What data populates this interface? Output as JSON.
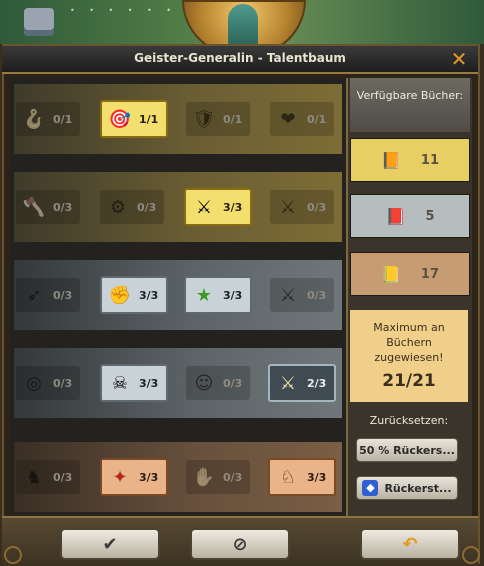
{
  "window": {
    "title": "Geister-Generalin  - Talentbaum",
    "close_icon": "close-x-icon"
  },
  "tree": {
    "rows": [
      {
        "tier": "gold",
        "talents": [
          {
            "icon": "horn-icon",
            "count": "0/1",
            "state": "inactive"
          },
          {
            "icon": "warrior-target-icon",
            "count": "1/1",
            "state": "gold-on"
          },
          {
            "icon": "shield-plus-icon",
            "count": "0/1",
            "state": "inactive"
          },
          {
            "icon": "heart-burst-icon",
            "count": "0/1",
            "state": "inactive"
          }
        ]
      },
      {
        "tier": "gold",
        "talents": [
          {
            "icon": "axe-icon",
            "count": "0/3",
            "state": "inactive"
          },
          {
            "icon": "catapult-icon",
            "count": "0/3",
            "state": "inactive"
          },
          {
            "icon": "crossed-swords-soldier-icon",
            "count": "3/3",
            "state": "gold-on"
          },
          {
            "icon": "swords-clock-icon",
            "count": "0/3",
            "state": "inactive"
          }
        ]
      },
      {
        "tier": "silver",
        "talents": [
          {
            "icon": "arrowhead-icon",
            "count": "0/3",
            "state": "inactive"
          },
          {
            "icon": "fist-icon",
            "count": "3/3",
            "state": "silver-on"
          },
          {
            "icon": "star-plus-icon",
            "count": "3/3",
            "state": "silver-on"
          },
          {
            "icon": "swords-plus-icon",
            "count": "0/3",
            "state": "inactive"
          }
        ]
      },
      {
        "tier": "silver",
        "talents": [
          {
            "icon": "target-arrow-icon",
            "count": "0/3",
            "state": "inactive"
          },
          {
            "icon": "skull-heart-icon",
            "count": "3/3",
            "state": "silver-on"
          },
          {
            "icon": "monk-plus-icon",
            "count": "0/3",
            "state": "inactive"
          },
          {
            "icon": "crossed-swords-soldier-icon",
            "count": "2/3",
            "state": "dark-on"
          }
        ]
      },
      {
        "tier": "bronze",
        "talents": [
          {
            "icon": "musketeer-icon",
            "count": "0/3",
            "state": "inactive"
          },
          {
            "icon": "fighter-icon",
            "count": "3/3",
            "state": "bronze-on"
          },
          {
            "icon": "handshake-icon",
            "count": "0/3",
            "state": "inactive"
          },
          {
            "icon": "horse-icon",
            "count": "3/3",
            "state": "bronze-on"
          }
        ]
      }
    ]
  },
  "side": {
    "available_label": "Verfügbare Bücher:",
    "books": [
      {
        "tier": "gold",
        "icon": "gold-book-icon",
        "value": "11"
      },
      {
        "tier": "silver",
        "icon": "silver-book-icon",
        "value": "5"
      },
      {
        "tier": "bronze",
        "icon": "bronze-book-icon",
        "value": "17"
      }
    ],
    "max_text": "Maximum an Büchern zugewiesen!",
    "max_value": "21/21",
    "reset_label": "Zurücksetzen:",
    "reset_half_label": "50 % Rückers...",
    "reset_full_label": "Rückerst...",
    "reset_full_icon": "gem-icon"
  },
  "footer": {
    "confirm_icon": "checkmark-icon",
    "cancel_icon": "cancel-circle-icon",
    "back_icon": "undo-arrow-icon"
  }
}
